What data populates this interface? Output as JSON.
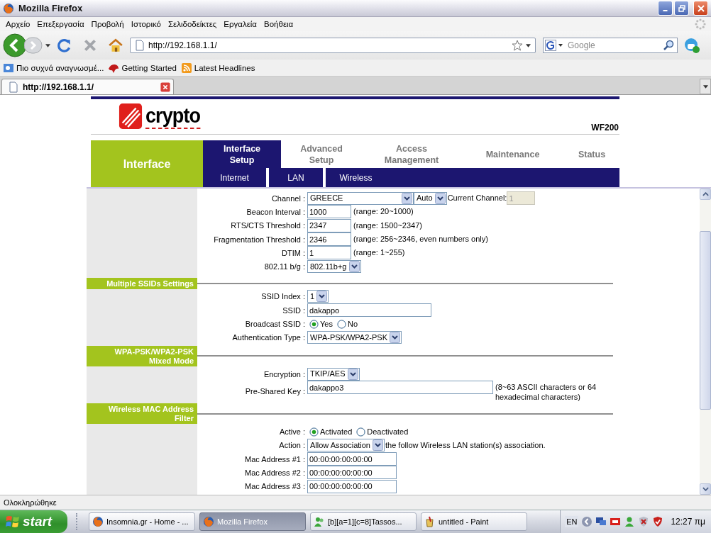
{
  "window": {
    "title": "Mozilla Firefox"
  },
  "menu": [
    "Αρχείο",
    "Επεξεργασία",
    "Προβολή",
    "Ιστορικό",
    "Σελιδοδείκτες",
    "Εργαλεία",
    "Βοήθεια"
  ],
  "toolbar": {
    "address": "http://192.168.1.1/",
    "search_placeholder": "Google"
  },
  "bookmarks": [
    "Πιο συχνά αναγνωσμέ...",
    "Getting Started",
    "Latest Headlines"
  ],
  "tabs": [
    {
      "label": "http://192.168.1.1/",
      "selected": true
    }
  ],
  "router": {
    "logo": "crypto",
    "model": "WF200",
    "section": "Interface",
    "nav": [
      {
        "label": "Interface Setup",
        "selected": true
      },
      {
        "label": "Advanced Setup",
        "selected": false
      },
      {
        "label": "Access Management",
        "selected": false
      },
      {
        "label": "Maintenance",
        "selected": false
      },
      {
        "label": "Status",
        "selected": false
      }
    ],
    "subnav": [
      "Internet",
      "LAN",
      "Wireless"
    ]
  },
  "sections": [
    {
      "rows": [
        {
          "label": "Channel :",
          "controls": [
            {
              "kind": "widelist",
              "value": "GREECE"
            },
            {
              "kind": "select",
              "value": "Auto"
            },
            {
              "kind": "text",
              "text": "Current Channel:"
            },
            {
              "kind": "readonly",
              "value": "1"
            }
          ]
        },
        {
          "label": "Beacon Interval :",
          "controls": [
            {
              "kind": "input",
              "value": "1000"
            },
            {
              "kind": "text",
              "text": "(range: 20~1000)"
            }
          ]
        },
        {
          "label": "RTS/CTS Threshold :",
          "controls": [
            {
              "kind": "input",
              "value": "2347"
            },
            {
              "kind": "text",
              "text": "(range: 1500~2347)"
            }
          ]
        },
        {
          "label": "Fragmentation Threshold :",
          "controls": [
            {
              "kind": "input",
              "value": "2346"
            },
            {
              "kind": "text",
              "text": "(range: 256~2346, even numbers only)"
            }
          ]
        },
        {
          "label": "DTIM :",
          "controls": [
            {
              "kind": "input",
              "value": "1"
            },
            {
              "kind": "text",
              "text": "(range: 1~255)"
            }
          ]
        },
        {
          "label": "802.11 b/g :",
          "controls": [
            {
              "kind": "select",
              "value": "802.11b+g"
            }
          ]
        }
      ]
    },
    {
      "title": "Multiple SSIDs Settings",
      "rows": [
        {
          "label": "SSID Index :",
          "controls": [
            {
              "kind": "select",
              "value": "1"
            }
          ]
        },
        {
          "label": "SSID :",
          "controls": [
            {
              "kind": "widefield",
              "value": "dakappo"
            }
          ]
        },
        {
          "label": "Broadcast SSID :",
          "controls": [
            {
              "kind": "radio",
              "text": "Yes",
              "selected": true
            },
            {
              "kind": "radio",
              "text": "No",
              "selected": false
            }
          ]
        },
        {
          "label": "Authentication Type :",
          "controls": [
            {
              "kind": "select",
              "value": "WPA-PSK/WPA2-PSK"
            }
          ]
        }
      ]
    },
    {
      "title": "WPA-PSK/WPA2-PSK Mixed Mode",
      "rows": [
        {
          "label": "Encryption :",
          "controls": [
            {
              "kind": "select",
              "value": "TKIP/AES"
            }
          ]
        },
        {
          "label": "Pre-Shared Key :",
          "controls": [
            {
              "kind": "longfield",
              "value": "dakappo3"
            },
            {
              "kind": "text",
              "text": "(8~63 ASCII characters or 64 hexadecimal characters)"
            }
          ]
        }
      ]
    },
    {
      "title": "Wireless MAC Address Filter",
      "rows": [
        {
          "label": "Active :",
          "controls": [
            {
              "kind": "radio",
              "text": "Activated",
              "selected": true
            },
            {
              "kind": "radio",
              "text": "Deactivated",
              "selected": false
            }
          ]
        },
        {
          "label": "Action :",
          "controls": [
            {
              "kind": "select",
              "value": "Allow Association"
            },
            {
              "kind": "text",
              "text": "the follow Wireless LAN station(s) association."
            }
          ]
        },
        {
          "label": "Mac Address #1 :",
          "controls": [
            {
              "kind": "macfield",
              "value": "00:00:00:00:00:00"
            }
          ]
        },
        {
          "label": "Mac Address #2 :",
          "controls": [
            {
              "kind": "macfield",
              "value": "00:00:00:00:00:00"
            }
          ]
        },
        {
          "label": "Mac Address #3 :",
          "controls": [
            {
              "kind": "macfield",
              "value": "00:00:00:00:00:00"
            }
          ]
        }
      ]
    }
  ],
  "status_bar": "Ολοκληρώθηκε",
  "taskbar": {
    "start": "start",
    "tasks": [
      {
        "label": "Insomnia.gr - Home - ...",
        "selected": false
      },
      {
        "label": "Mozilla Firefox",
        "selected": true
      },
      {
        "label": "[b][a=1][c=8]Tassos...",
        "selected": false
      },
      {
        "label": "untitled - Paint",
        "selected": false
      }
    ],
    "language": "EN",
    "clock": "12:27 πμ"
  }
}
